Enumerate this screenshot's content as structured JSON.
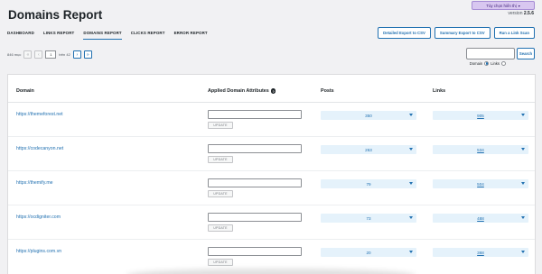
{
  "user_menu": {
    "label": "Tùy chọn hiển thị"
  },
  "header": {
    "title": "Domains Report",
    "version_label": "version",
    "version_number": "2.5.6"
  },
  "tabs": [
    {
      "label": "DASHBOARD",
      "active": false
    },
    {
      "label": "LINKS REPORT",
      "active": false
    },
    {
      "label": "DOMAINS REPORT",
      "active": true
    },
    {
      "label": "CLICKS REPORT",
      "active": false
    },
    {
      "label": "ERROR REPORT",
      "active": false
    }
  ],
  "export_buttons": {
    "detailed": "Detailed Export to CSV",
    "summary": "Summary Export to CSV",
    "scan": "Run a Link Scan"
  },
  "pagination": {
    "items": "846 mục",
    "first": "«",
    "prev": "‹",
    "current": "1",
    "of_total": "trên 42",
    "next": "›",
    "last": "»"
  },
  "search": {
    "value": "",
    "button": "Search",
    "option_domain": "Domain",
    "option_links": "Links",
    "selected": "Domain"
  },
  "table": {
    "headers": {
      "domain": "Domain",
      "attributes": "Applied Domain Attributes",
      "posts": "Posts",
      "links": "Links"
    },
    "update_label": "UPDATE",
    "rows": [
      {
        "domain": "https://themeforest.net",
        "posts": "350",
        "links": "905"
      },
      {
        "domain": "https://codecanyon.net",
        "posts": "263",
        "links": "534"
      },
      {
        "domain": "https://themify.me",
        "posts": "79",
        "links": "504"
      },
      {
        "domain": "https://ocdigniter.com",
        "posts": "73",
        "links": "488"
      },
      {
        "domain": "https://plugins.com.vn",
        "posts": "20",
        "links": "368"
      }
    ]
  },
  "colors": {
    "accent": "#2271b1",
    "dropdown_bg": "#e5f2fb",
    "menu_bg": "#d8c7f0"
  }
}
